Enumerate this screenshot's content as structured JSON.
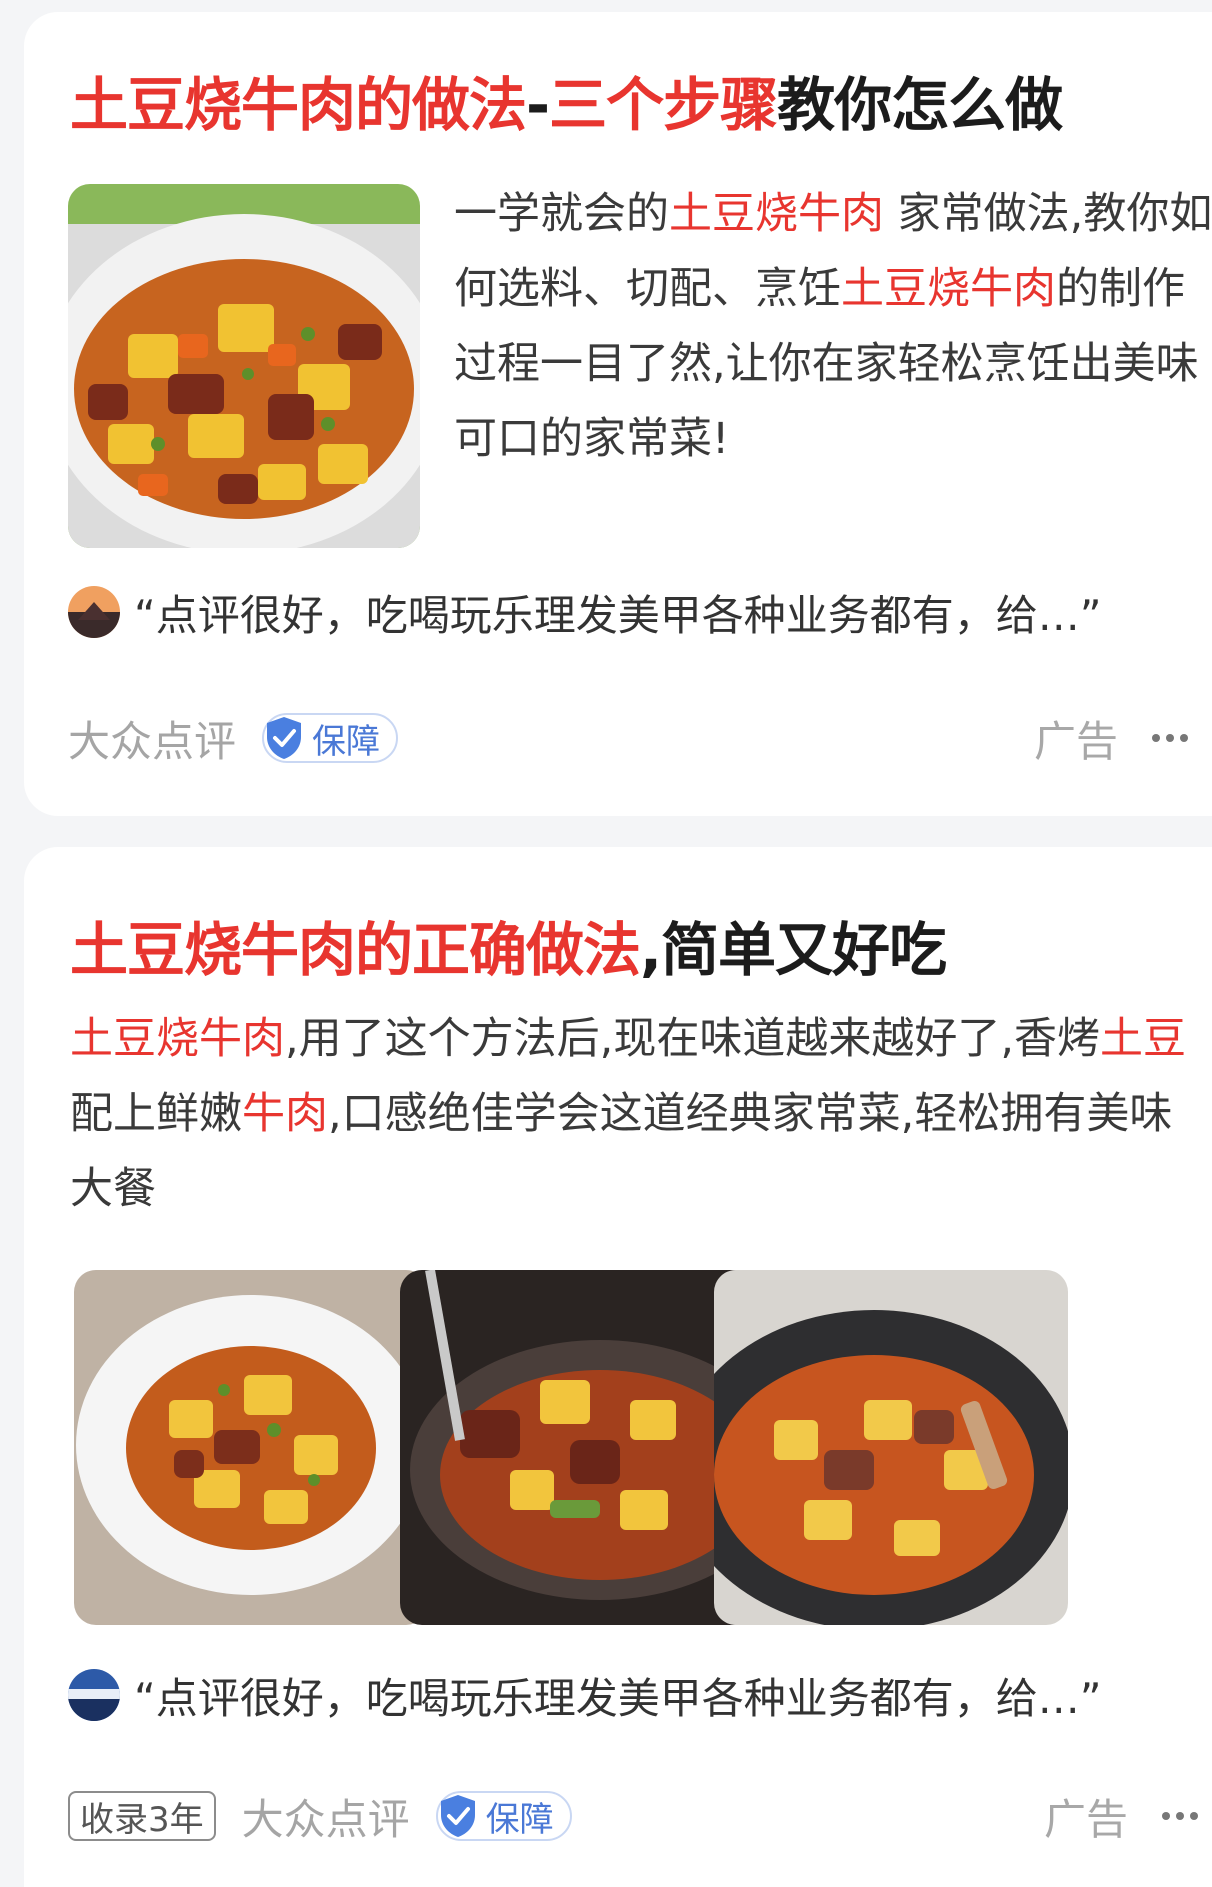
{
  "card1": {
    "title_red1": "土豆烧牛肉的做法",
    "title_dash": "-",
    "title_red2": "三个步骤",
    "title_dark": "教你怎么做",
    "desc": {
      "p1": "一学就会的",
      "h1": "土豆烧牛肉",
      "p2": " 家常做法,教你如何选料、切配、烹饪",
      "h2": "土豆烧牛肉",
      "p3": "的制作过程一目了然,让你在家轻松烹饪出美味可口的家常菜!"
    },
    "comment": "“点评很好，吃喝玩乐理发美甲各种业务都有，给…”",
    "source": "大众点评",
    "badge": "保障",
    "ad": "广告"
  },
  "card2": {
    "title_red": "土豆烧牛肉的正确做法",
    "title_dark": ",简单又好吃",
    "desc": {
      "h1": "土豆烧牛肉",
      "p1": ",用了这个方法后,现在味道越来越好了,香烤",
      "h2": "土豆",
      "p2": "配上鲜嫩",
      "h3": "牛肉",
      "p3": ",口感绝佳学会这道经典家常菜,轻松拥有美味大餐"
    },
    "comment": "“点评很好，吃喝玩乐理发美甲各种业务都有，给…”",
    "years": "收录3年",
    "source": "大众点评",
    "badge": "保障",
    "ad": "广告"
  },
  "colors": {
    "highlight": "#e8352f",
    "badge_blue": "#4a78d6",
    "background": "#f4f5f7"
  },
  "icons": [
    "shield-check-icon",
    "more-dots-icon"
  ]
}
